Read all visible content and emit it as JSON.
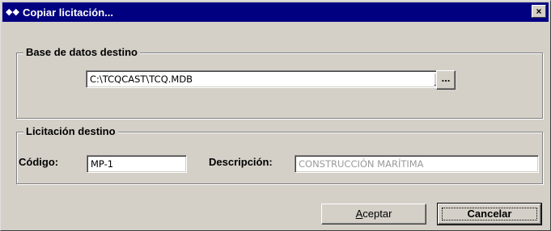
{
  "window": {
    "title": "Copiar licitación...",
    "title_icon": "app-icon",
    "close_label": "×"
  },
  "database_group": {
    "legend": "Base de datos destino",
    "path_value": "C:\\TCQCAST\\TCQ.MDB",
    "dropdown_icon": "▼",
    "browse_label": "..."
  },
  "bid_group": {
    "legend": "Licitación destino",
    "code_label": "Código:",
    "code_value": "MP-1",
    "description_label": "Descripción:",
    "description_value": "CONSTRUCCIÓN MARÍTIMA"
  },
  "buttons": {
    "accept_label_accel": "A",
    "accept_label_rest": "ceptar",
    "cancel_label": "Cancelar"
  }
}
